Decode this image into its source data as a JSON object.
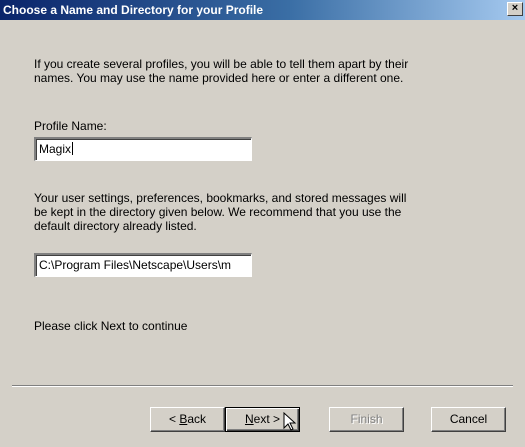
{
  "window": {
    "title": "Choose a Name and Directory for your Profile",
    "close_glyph": "×"
  },
  "content": {
    "intro_line1": "If you create several profiles, you will be able to tell them apart by their",
    "intro_line2": "names.  You may use the name provided here or enter a different one.",
    "profile_name_label": "Profile Name:",
    "profile_name_value": "Magix",
    "dir_line1": "Your user settings, preferences, bookmarks, and stored messages will",
    "dir_line2": "be kept in the directory given below.  We recommend that you use the",
    "dir_line3": "default directory already listed.",
    "directory_value": "C:\\Program Files\\Netscape\\Users\\m",
    "continue_text": "Please click Next to continue"
  },
  "buttons": {
    "back_prefix": "< ",
    "back_mnemonic": "B",
    "back_rest": "ack",
    "next_mnemonic": "N",
    "next_rest": "ext >",
    "finish": "Finish",
    "cancel": "Cancel"
  },
  "icons": {
    "cursor": "mouse-pointer-icon"
  }
}
